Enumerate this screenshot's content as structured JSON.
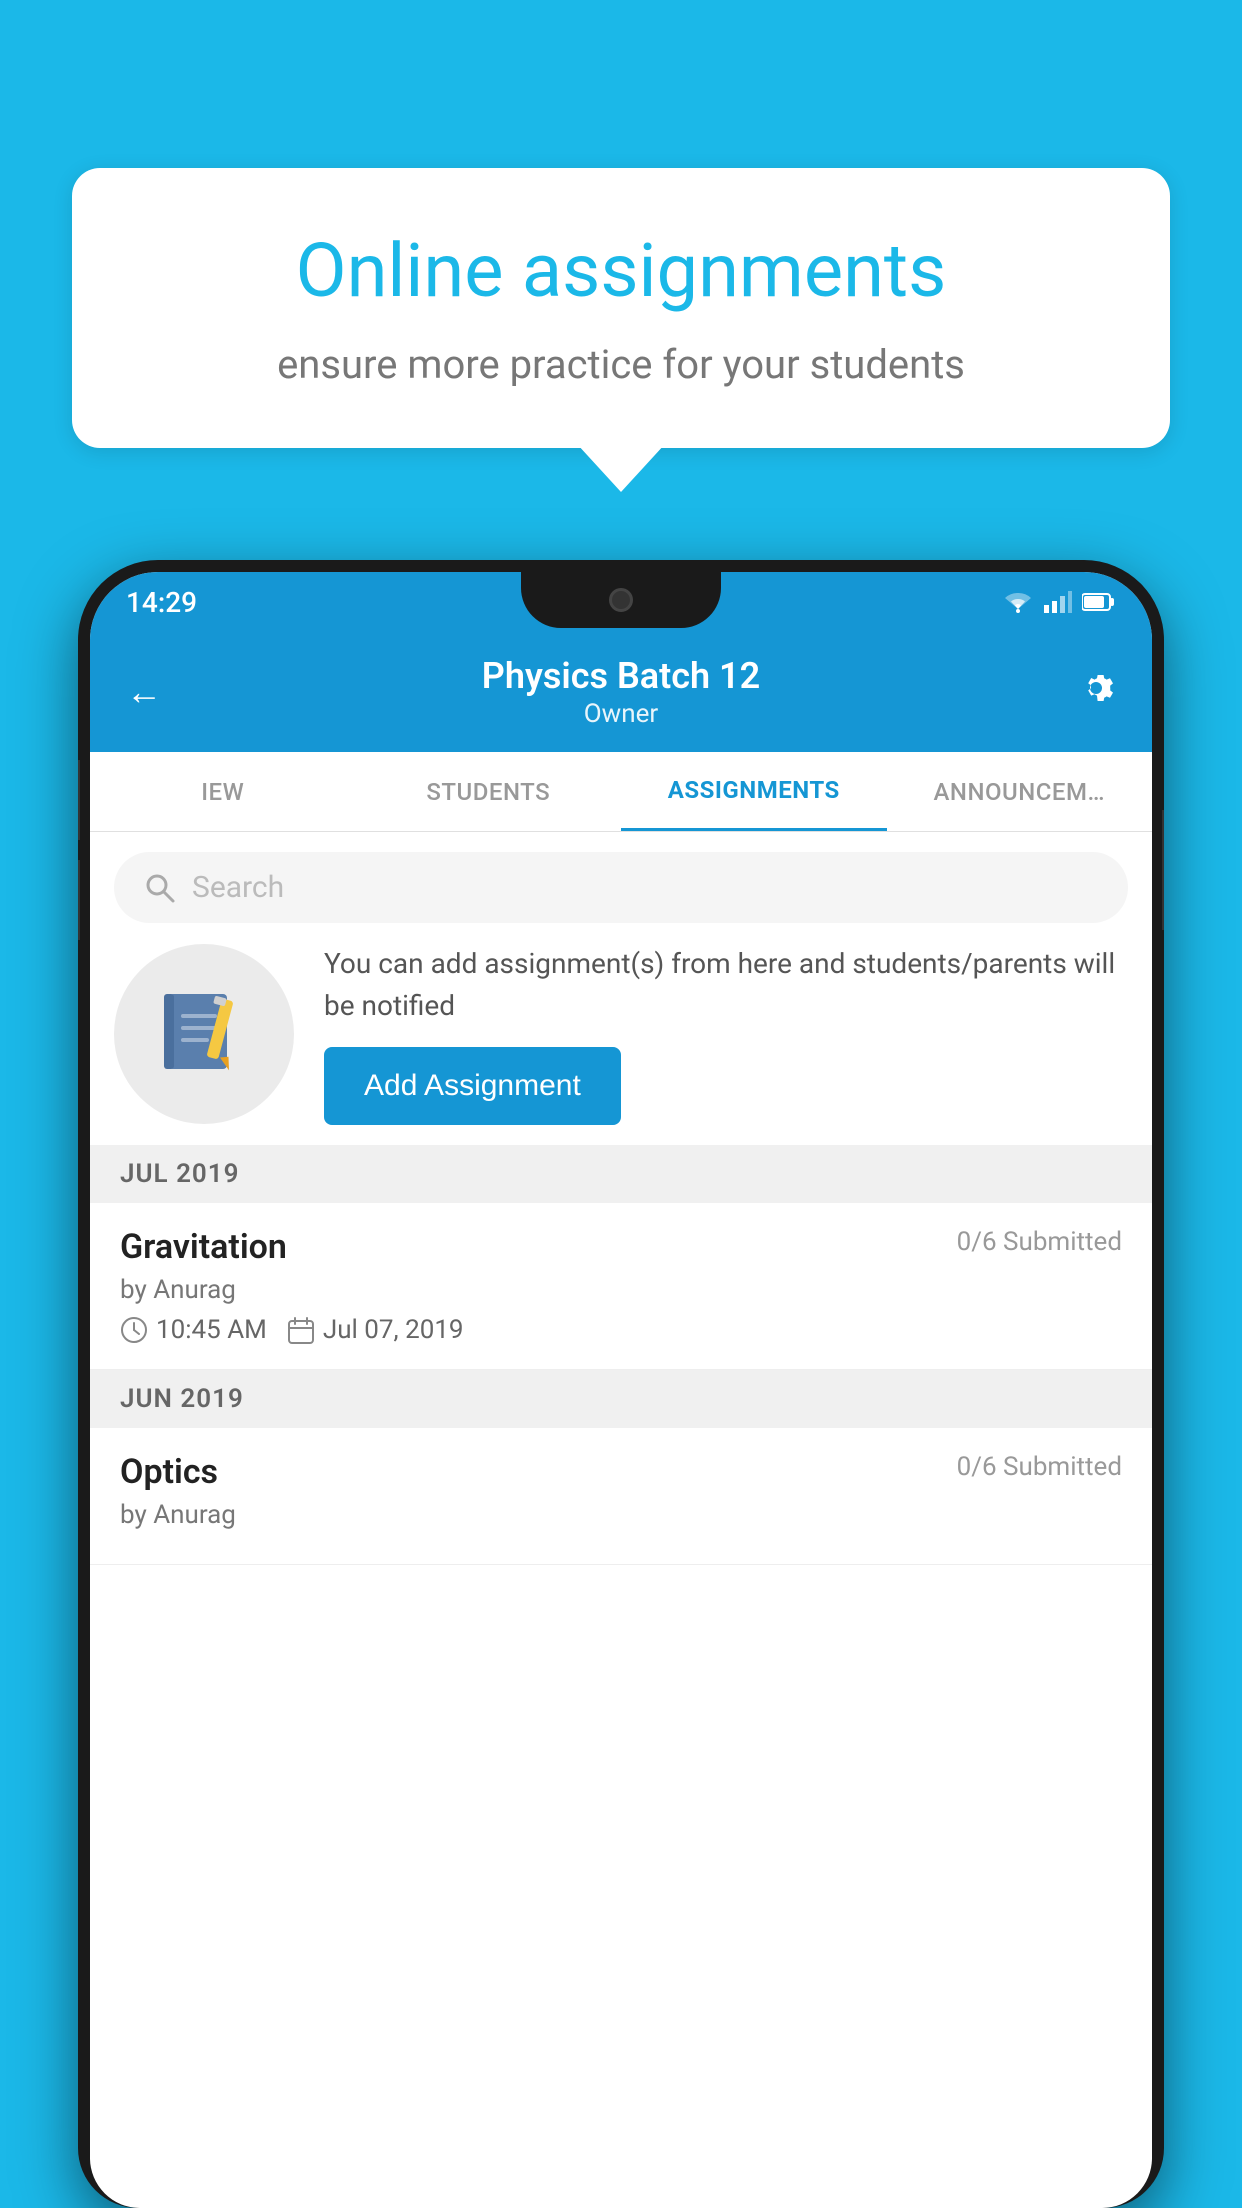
{
  "background": {
    "color": "#1bb8e8"
  },
  "speech_bubble": {
    "title": "Online assignments",
    "subtitle": "ensure more practice for your students"
  },
  "status_bar": {
    "time": "14:29",
    "icons": [
      "wifi",
      "signal",
      "battery"
    ]
  },
  "app_header": {
    "title": "Physics Batch 12",
    "subtitle": "Owner",
    "back_label": "←",
    "settings_label": "⚙"
  },
  "tabs": [
    {
      "label": "IEW",
      "active": false
    },
    {
      "label": "STUDENTS",
      "active": false
    },
    {
      "label": "ASSIGNMENTS",
      "active": true
    },
    {
      "label": "ANNOUNCEM…",
      "active": false
    }
  ],
  "search": {
    "placeholder": "Search"
  },
  "empty_state": {
    "description": "You can add assignment(s) from here and students/parents will be notified",
    "button_label": "Add Assignment"
  },
  "sections": [
    {
      "month_label": "JUL 2019",
      "assignments": [
        {
          "name": "Gravitation",
          "submitted": "0/6 Submitted",
          "by": "by Anurag",
          "time": "10:45 AM",
          "date": "Jul 07, 2019"
        }
      ]
    },
    {
      "month_label": "JUN 2019",
      "assignments": [
        {
          "name": "Optics",
          "submitted": "0/6 Submitted",
          "by": "by Anurag",
          "time": "",
          "date": ""
        }
      ]
    }
  ]
}
